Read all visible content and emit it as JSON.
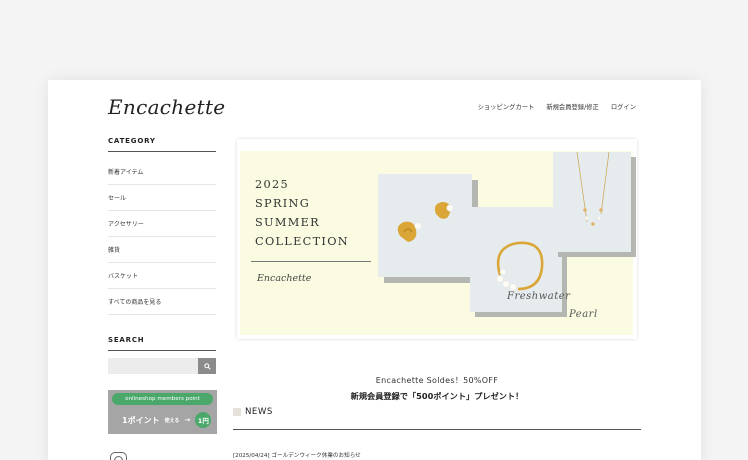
{
  "site": {
    "logo": "Encachette"
  },
  "header": {
    "nav": [
      "ショッピングカート",
      "新規会員登録/修正",
      "ログイン"
    ]
  },
  "sidebar": {
    "category_heading": "CATEGORY",
    "categories": [
      "新着アイテム",
      "セール",
      "アクセサリー",
      "雑貨",
      "バスケット",
      "すべての商品を見る"
    ],
    "search_heading": "SEARCH",
    "search_placeholder": "",
    "points_banner": {
      "title": "onlineshop members point",
      "left": "1ポイント",
      "middle": "使える",
      "right": "1円"
    }
  },
  "banner": {
    "title": "2025\nSPRING\nSUMMER\nCOLLECTION",
    "brand": "Encachette",
    "script_line1": "Freshwater",
    "script_line2": "Pearl"
  },
  "promo": {
    "line1": "Encachette Soldes！50%OFF",
    "line2": "新規会員登録で「500ポイント」プレゼント！"
  },
  "news": {
    "heading": "NEWS",
    "items": [
      "[2025/04/24] ゴールデンウィーク休業のお知らせ"
    ]
  },
  "colors": {
    "banner_bg": "#fbfbe2",
    "points_green": "#4aa86a",
    "search_button": "#8b8b8b"
  }
}
